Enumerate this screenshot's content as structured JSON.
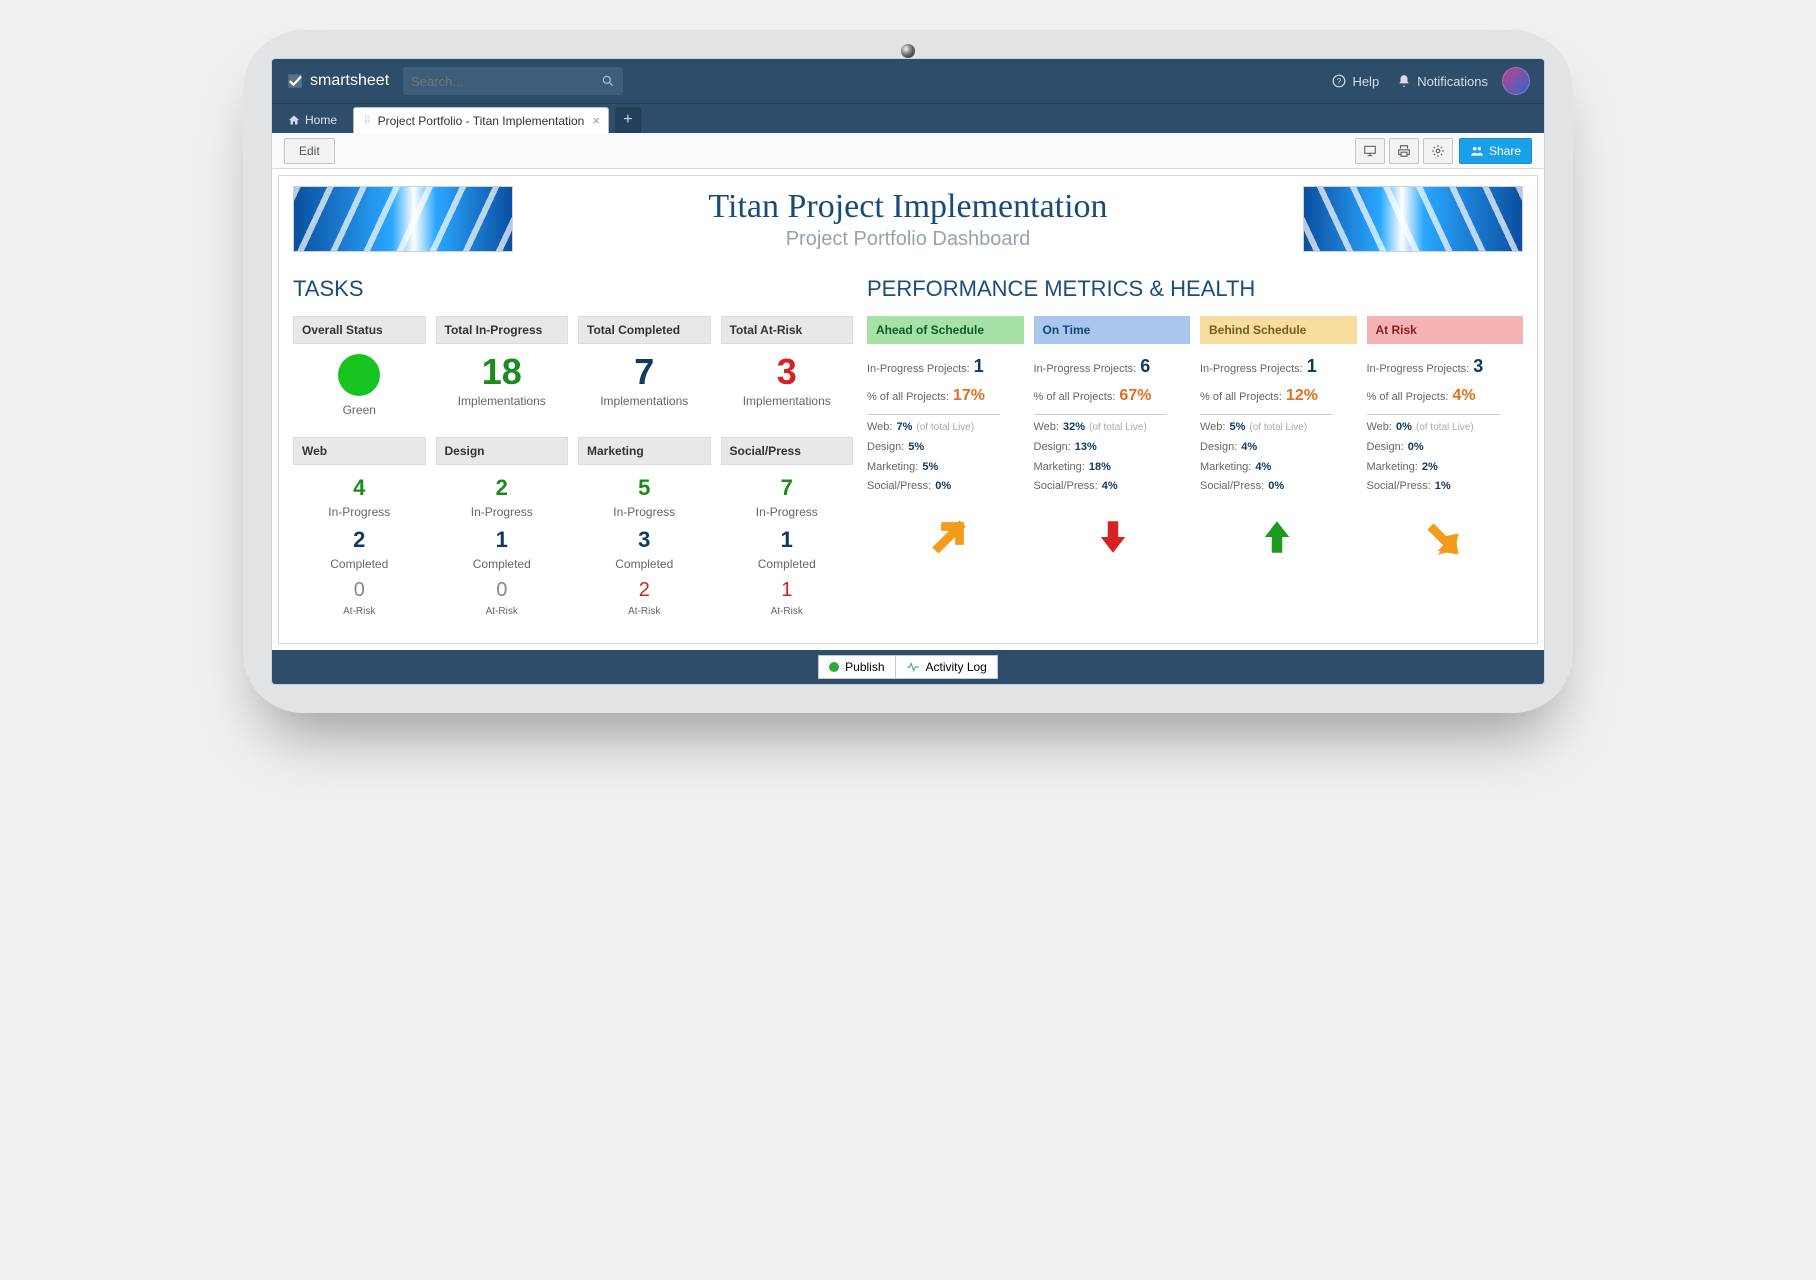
{
  "app": {
    "brand": "smartsheet"
  },
  "search": {
    "placeholder": "Search..."
  },
  "nav": {
    "help": "Help",
    "notifications": "Notifications"
  },
  "tabs": {
    "home": "Home",
    "active": "Project Portfolio - Titan Implementation"
  },
  "toolbar": {
    "edit": "Edit",
    "share": "Share"
  },
  "header": {
    "title": "Titan Project Implementation",
    "subtitle": "Project Portfolio Dashboard"
  },
  "sections": {
    "tasks": "TASKS",
    "perf": "PERFORMANCE METRICS & HEALTH"
  },
  "tasks_top": [
    {
      "head": "Overall Status",
      "big": "",
      "sub": "Green",
      "style": "dot"
    },
    {
      "head": "Total In-Progress",
      "big": "18",
      "sub": "Implementations",
      "style": "green"
    },
    {
      "head": "Total Completed",
      "big": "7",
      "sub": "Implementations",
      "style": "navy"
    },
    {
      "head": "Total At-Risk",
      "big": "3",
      "sub": "Implementations",
      "style": "red"
    }
  ],
  "tasks_bottom": [
    {
      "head": "Web",
      "inprog": "4",
      "compl": "2",
      "atrisk": "0",
      "atrisk_style": "grey"
    },
    {
      "head": "Design",
      "inprog": "2",
      "compl": "1",
      "atrisk": "0",
      "atrisk_style": "grey"
    },
    {
      "head": "Marketing",
      "inprog": "5",
      "compl": "3",
      "atrisk": "2",
      "atrisk_style": "red"
    },
    {
      "head": "Social/Press",
      "inprog": "7",
      "compl": "1",
      "atrisk": "1",
      "atrisk_style": "red"
    }
  ],
  "tasks_labels": {
    "inprog": "In-Progress",
    "compl": "Completed",
    "atrisk": "At-Risk"
  },
  "perf": [
    {
      "head": "Ahead of Schedule",
      "cls": "perf-green",
      "inprog": "1",
      "pct": "17%",
      "web": "7%",
      "design": "5%",
      "marketing": "5%",
      "social": "0%",
      "arrow": "up-right-orange"
    },
    {
      "head": "On Time",
      "cls": "perf-blue",
      "inprog": "6",
      "pct": "67%",
      "web": "32%",
      "design": "13%",
      "marketing": "18%",
      "social": "4%",
      "arrow": "down-red"
    },
    {
      "head": "Behind Schedule",
      "cls": "perf-yellow",
      "inprog": "1",
      "pct": "12%",
      "web": "5%",
      "design": "4%",
      "marketing": "4%",
      "social": "0%",
      "arrow": "up-green"
    },
    {
      "head": "At Risk",
      "cls": "perf-red",
      "inprog": "3",
      "pct": "4%",
      "web": "0%",
      "design": "0%",
      "marketing": "2%",
      "social": "1%",
      "arrow": "down-right-orange"
    }
  ],
  "perf_labels": {
    "inprog": "In-Progress Projects:",
    "pct": "% of all Projects:",
    "web": "Web:",
    "design": "Design:",
    "marketing": "Marketing:",
    "social": "Social/Press:",
    "oftotal": "(of total Live)"
  },
  "bottom": {
    "publish": "Publish",
    "activity": "Activity Log"
  }
}
